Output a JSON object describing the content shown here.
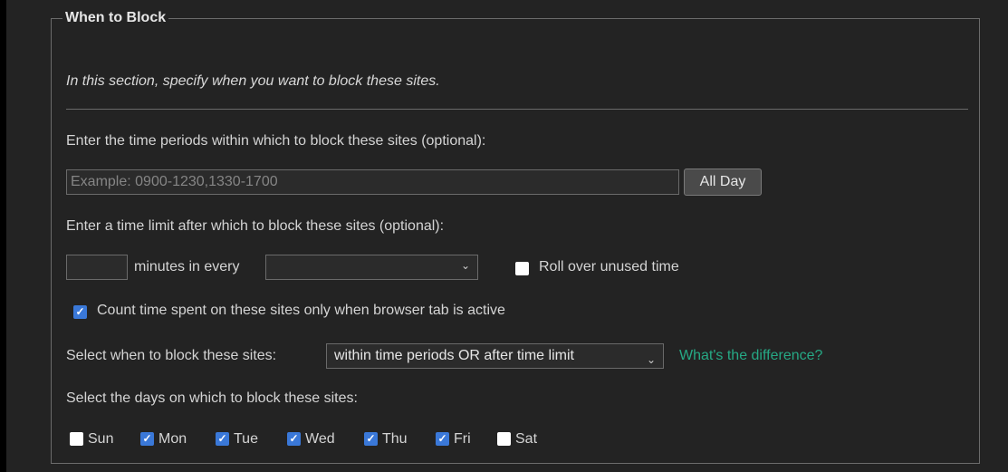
{
  "section": {
    "legend": "When to Block",
    "intro": "In this section, specify when you want to block these sites.",
    "time_periods": {
      "label": "Enter the time periods within which to block these sites (optional):",
      "placeholder": "Example: 0900-1230,1330-1700",
      "value": "",
      "all_day_button": "All Day"
    },
    "time_limit": {
      "label": "Enter a time limit after which to block these sites (optional):",
      "minutes_value": "",
      "minutes_text": "minutes in every",
      "period_selected": "",
      "rollover": {
        "label": "Roll over unused time",
        "checked": false
      }
    },
    "count_active": {
      "label": "Count time spent on these sites only when browser tab is active",
      "checked": true
    },
    "block_mode": {
      "label": "Select when to block these sites:",
      "selected": "within time periods OR after time limit",
      "help_link": "What's the difference?"
    },
    "days": {
      "label": "Select the days on which to block these sites:",
      "items": [
        {
          "label": "Sun",
          "checked": false
        },
        {
          "label": "Mon",
          "checked": true
        },
        {
          "label": "Tue",
          "checked": true
        },
        {
          "label": "Wed",
          "checked": true
        },
        {
          "label": "Thu",
          "checked": true
        },
        {
          "label": "Fri",
          "checked": true
        },
        {
          "label": "Sat",
          "checked": false
        }
      ]
    }
  },
  "colors": {
    "background": "#232323",
    "border": "#6b6b6b",
    "text": "#d4d4d4",
    "link": "#26a985",
    "checkbox_checked": "#3a78d8"
  },
  "icons": {
    "dropdown": "chevron-down-icon",
    "check": "checkmark-icon"
  }
}
